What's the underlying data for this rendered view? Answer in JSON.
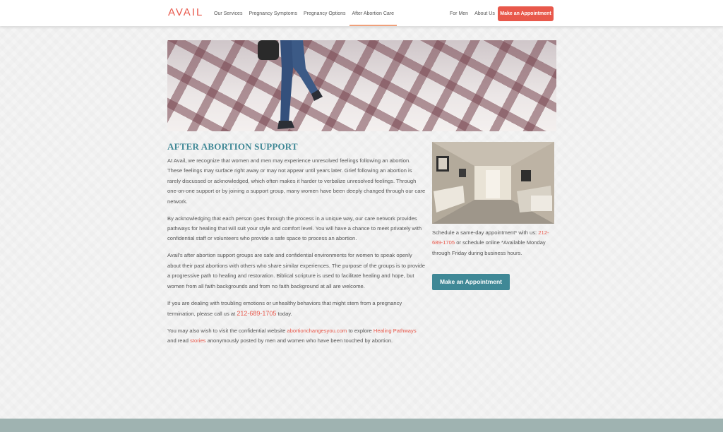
{
  "header": {
    "logo": "AVAIL",
    "nav_left": [
      "Our Services",
      "Pregnancy Symptoms",
      "Pregnancy Options",
      "After Abortion Care"
    ],
    "active_item": "After Abortion Care",
    "nav_right": [
      "For Men",
      "About Us"
    ],
    "cta_label": "Make an Appointment"
  },
  "main": {
    "title": "AFTER ABORTION SUPPORT",
    "p1": "At Avail, we recognize that women and men may experience unresolved feelings following an abortion. These feelings may surface right away or may not appear until years later. Grief following an abortion is rarely discussed or acknowledged, which often makes it harder to verbalize unresolved feelings. Through one-on-one support or by joining a support group, many women have been deeply changed through our care network.",
    "p2": "By acknowledging that each person goes through the process in a unique way, our care network provides pathways for healing that will suit your style and comfort level. You will have a chance to meet privately with confidential staff or volunteers who provide a safe space to process an abortion.",
    "p3": "Avail’s after abortion support groups are safe and confidential environments for women to speak openly about their past abortions with others who share similar experiences. The purpose of the groups is to provide a progressive path to healing and restoration. Biblical scripture is used to facilitate healing and hope, but women from all faith backgrounds and from no faith background at all are welcome.",
    "p4_before": "If you are dealing with troubling emotions or unhealthy behaviors that might stem from a pregnancy termination, please call us at ",
    "p4_phone": "212-689-1705",
    "p4_after": " today.",
    "p5_a": "You may also wish to visit the confidential website ",
    "p5_link1": "abortionchangesyou.com",
    "p5_b": " to explore ",
    "p5_link2": "Healing Pathways",
    "p5_c": " and read ",
    "p5_link3": "stories",
    "p5_d": " anonymously posted by men and women who have been touched by abortion."
  },
  "sidebar": {
    "text_before": "Schedule a same-day appointment* with us: ",
    "phone": "212-689-1705",
    "text_after": " or schedule online *Available Monday through Friday during business hours.",
    "cta_label": "Make an Appointment"
  },
  "colors": {
    "brand": "#e8584b",
    "teal": "#3f8896",
    "footer": "#9fb3b1"
  }
}
